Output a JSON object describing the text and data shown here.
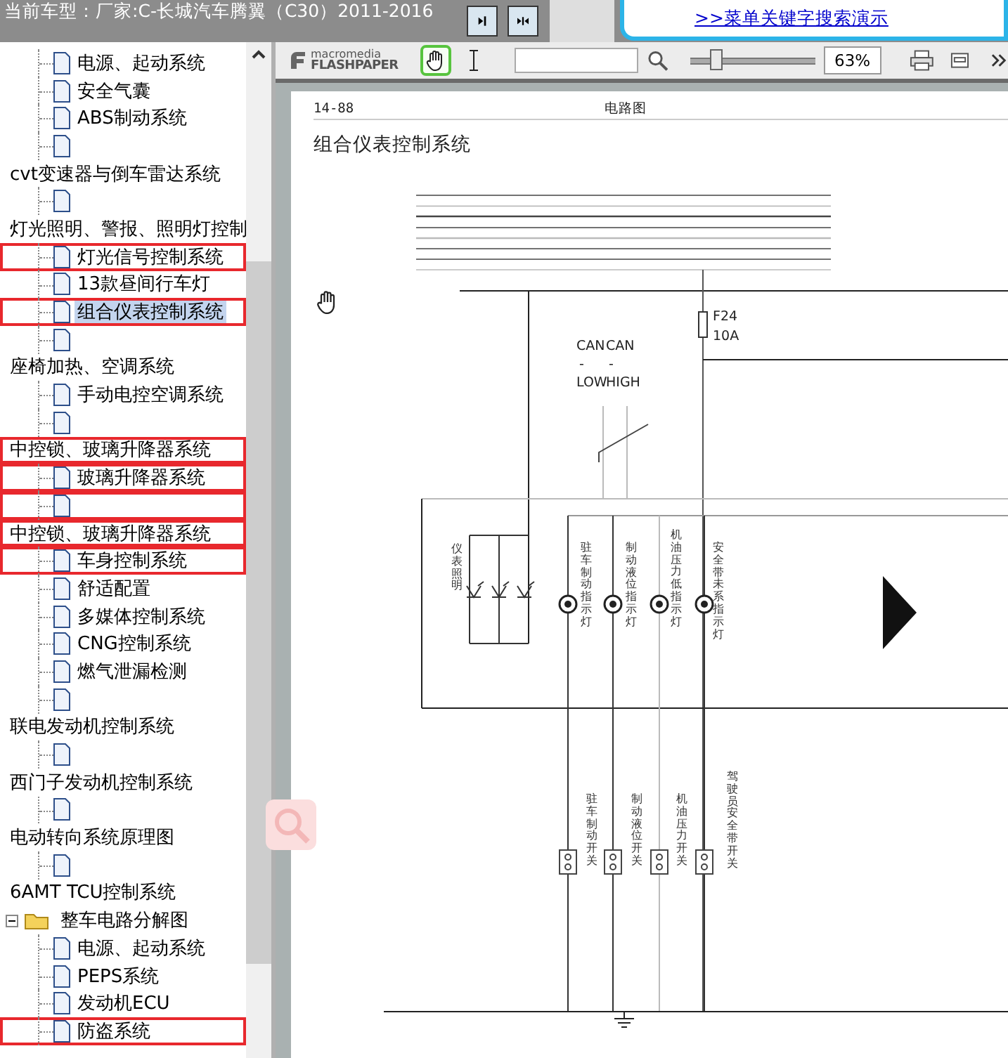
{
  "header": {
    "car_model": "当前车型：厂家:C-长城汽车腾翼（C30）2011-2016",
    "demo_link": ">>菜单关键字搜索演示"
  },
  "tree": [
    {
      "kind": "doc",
      "label": "电源、起动系统",
      "selected": false,
      "boxed": false
    },
    {
      "kind": "doc",
      "label": "安全气囊",
      "selected": false,
      "boxed": false
    },
    {
      "kind": "doc",
      "label": "ABS制动系统",
      "selected": false,
      "boxed": false
    },
    {
      "kind": "doc",
      "selected": false,
      "boxed": false
    },
    {
      "kind": "group",
      "label": "cvt变速器与倒车雷达系统",
      "selected": false,
      "boxed": false,
      "children": [
        {
          "kind": "doc",
          "selected": false,
          "boxed": false
        }
      ]
    },
    {
      "kind": "group",
      "label": "灯光照明、警报、照明灯控制",
      "selected": false,
      "boxed": false,
      "children": [
        {
          "kind": "doc",
          "label": "灯光信号控制系统",
          "selected": false,
          "boxed": true
        },
        {
          "kind": "doc",
          "label": "13款昼间行车灯",
          "selected": false,
          "boxed": false
        },
        {
          "kind": "doc",
          "label": "组合仪表控制系统",
          "selected": true,
          "boxed": true
        },
        {
          "kind": "doc",
          "selected": false,
          "boxed": false
        }
      ]
    },
    {
      "kind": "group",
      "label": "座椅加热、空调系统",
      "selected": false,
      "boxed": false,
      "children": [
        {
          "kind": "doc",
          "label": "手动电控空调系统",
          "selected": false,
          "boxed": false
        },
        {
          "kind": "doc",
          "selected": false,
          "boxed": false
        }
      ]
    },
    {
      "kind": "group",
      "label": "中控锁、玻璃升降器系统",
      "selected": false,
      "boxed": true,
      "children": [
        {
          "kind": "doc",
          "label": "玻璃升降器系统",
          "selected": false,
          "boxed": true
        },
        {
          "kind": "doc",
          "selected": false,
          "boxed": true
        }
      ]
    },
    {
      "kind": "group",
      "label": "中控锁、玻璃升降器系统",
      "selected": false,
      "boxed": true,
      "children": [
        {
          "kind": "doc",
          "label": "车身控制系统",
          "selected": false,
          "boxed": true
        },
        {
          "kind": "doc",
          "label": "舒适配置",
          "selected": false,
          "boxed": false
        },
        {
          "kind": "doc",
          "label": "多媒体控制系统",
          "selected": false,
          "boxed": false
        },
        {
          "kind": "doc",
          "label": "CNG控制系统",
          "selected": false,
          "boxed": false
        },
        {
          "kind": "doc",
          "label": "燃气泄漏检测",
          "selected": false,
          "boxed": false
        },
        {
          "kind": "doc",
          "selected": false,
          "boxed": false
        }
      ]
    },
    {
      "kind": "group",
      "label": "联电发动机控制系统",
      "selected": false,
      "boxed": false,
      "children": [
        {
          "kind": "doc",
          "selected": false,
          "boxed": false
        }
      ]
    },
    {
      "kind": "group",
      "label": "西门子发动机控制系统",
      "selected": false,
      "boxed": false,
      "children": [
        {
          "kind": "doc",
          "selected": false,
          "boxed": false
        }
      ]
    },
    {
      "kind": "group",
      "label": "电动转向系统原理图",
      "selected": false,
      "boxed": false,
      "children": [
        {
          "kind": "doc",
          "selected": false,
          "boxed": false
        }
      ]
    },
    {
      "kind": "group",
      "label": "6AMT TCU控制系统",
      "selected": false,
      "boxed": false
    },
    {
      "kind": "folder",
      "label": "整车电路分解图",
      "selected": false,
      "boxed": false,
      "expanded": true,
      "children": [
        {
          "kind": "doc",
          "label": "电源、起动系统",
          "selected": false,
          "boxed": false
        },
        {
          "kind": "doc",
          "label": "PEPS系统",
          "selected": false,
          "boxed": false
        },
        {
          "kind": "doc",
          "label": "发动机ECU",
          "selected": false,
          "boxed": false
        },
        {
          "kind": "doc",
          "label": "防盗系统",
          "selected": false,
          "boxed": true
        }
      ]
    }
  ],
  "viewer": {
    "logo_top": "macromedia",
    "logo_bottom": "FLASHPAPER",
    "tools": [
      {
        "kind": "hand",
        "selected": true
      },
      {
        "kind": "text-select",
        "selected": false
      }
    ],
    "zoom": {
      "level": 0.2,
      "reading": "63%"
    },
    "page": {
      "number": "14-88",
      "section": "电路图",
      "title": "组合仪表控制系统",
      "diagram": {
        "fuse": {
          "name": "F24",
          "rating": "10A"
        },
        "can": [
          {
            "top": "CAN",
            "mid": "-",
            "bottom": "LOW"
          },
          {
            "top": "CAN",
            "mid": "-",
            "bottom": "HIGH"
          }
        ],
        "illumination": "仪表照明",
        "indicators": [
          {
            "lamp": "驻车制动指示灯",
            "switch": "驻车制动开关"
          },
          {
            "lamp": "制动液位指示灯",
            "switch": "制动液位开关"
          },
          {
            "lamp": "机油压力低指示灯",
            "switch": "机油压力开关"
          },
          {
            "lamp": "安全带未系指示灯",
            "switch": "驾驶员安全带开关"
          }
        ]
      }
    }
  }
}
